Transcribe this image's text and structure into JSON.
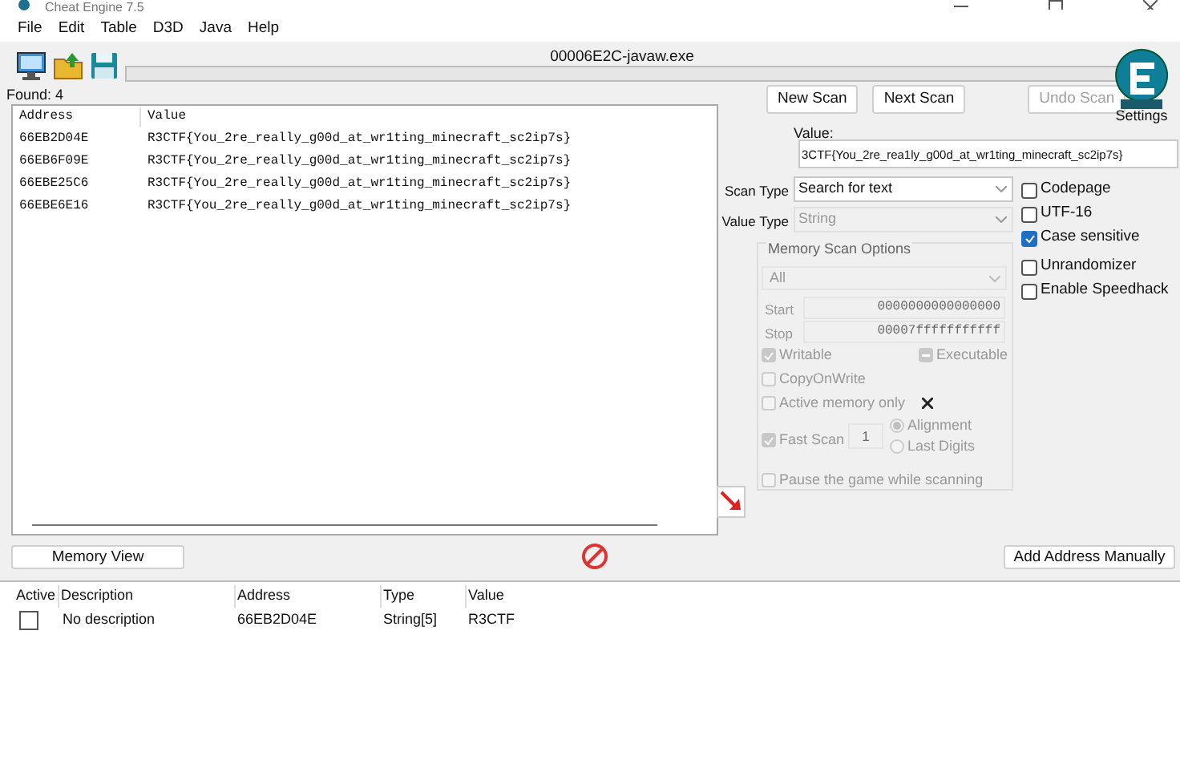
{
  "window": {
    "title": "Cheat Engine 7.5"
  },
  "menu": [
    "File",
    "Edit",
    "Table",
    "D3D",
    "Java",
    "Help"
  ],
  "process_name": "00006E2C-javaw.exe",
  "progress": {
    "level": 0
  },
  "found": "Found: 4",
  "results": {
    "columns": [
      "Address",
      "Value"
    ],
    "rows": [
      [
        "66EB2D04E",
        "R3CTF{You_2re_really_g00d_at_wr1ting_minecraft_sc2ip7s}"
      ],
      [
        "66EB6F09E",
        "R3CTF{You_2re_really_g00d_at_wr1ting_minecraft_sc2ip7s}"
      ],
      [
        "66EBE25C6",
        "R3CTF{You_2re_really_g00d_at_wr1ting_minecraft_sc2ip7s}"
      ],
      [
        "66EBE6E16",
        "R3CTF{You_2re_really_g00d_at_wr1ting_minecraft_sc2ip7s}"
      ]
    ]
  },
  "scan_buttons": [
    {
      "label": "New Scan",
      "disabled": false
    },
    {
      "label": "Next Scan",
      "disabled": false
    },
    {
      "label": "Undo Scan",
      "disabled": true
    }
  ],
  "settings_label": "Settings",
  "value": {
    "label": "Value:",
    "value": "3CTF{You_2re_rea1ly_g00d_at_wr1ting_minecraft_sc2ip7s}"
  },
  "scan_type": {
    "label": "Scan Type",
    "value": "Search for text",
    "disabled": false
  },
  "value_type": {
    "label": "Value Type",
    "value": "String",
    "disabled": true
  },
  "options": [
    {
      "label": "Codepage",
      "checked": false
    },
    {
      "label": "UTF-16",
      "checked": false
    },
    {
      "label": "Case sensitive",
      "checked": true
    },
    {
      "label": "Unrandomizer",
      "checked": false
    },
    {
      "label": "Enable Speedhack",
      "checked": false
    }
  ],
  "memory_scan_options": {
    "title": "Memory Scan Options",
    "disabled": true,
    "region": "All",
    "start": {
      "label": "Start",
      "value": "0000000000000000"
    },
    "stop": {
      "label": "Stop",
      "value": "00007fffffffffff"
    },
    "writable": {
      "label": "Writable",
      "checked": true
    },
    "executable": {
      "label": "Executable",
      "checked": true,
      "indeterminate": true
    },
    "copy_on_write": {
      "label": "CopyOnWrite",
      "checked": false
    },
    "active_memory_only": {
      "label": "Active memory only",
      "checked": false
    },
    "fast_scan": {
      "label": "Fast Scan",
      "checked": true,
      "value": "1"
    },
    "alignment": [
      {
        "label": "Alignment",
        "selected": true
      },
      {
        "label": "Last Digits",
        "selected": false
      }
    ],
    "pause": {
      "label": "Pause the game while scanning",
      "checked": false
    }
  },
  "buttons": {
    "memory_view": "Memory View",
    "add_address": "Add Address Manually"
  },
  "address_list": {
    "columns": [
      "Active",
      "Description",
      "Address",
      "Type",
      "Value"
    ],
    "rows": [
      {
        "active": false,
        "description": "No description",
        "address": "66EB2D04E",
        "type": "String[5]",
        "value": "R3CTF"
      }
    ]
  }
}
